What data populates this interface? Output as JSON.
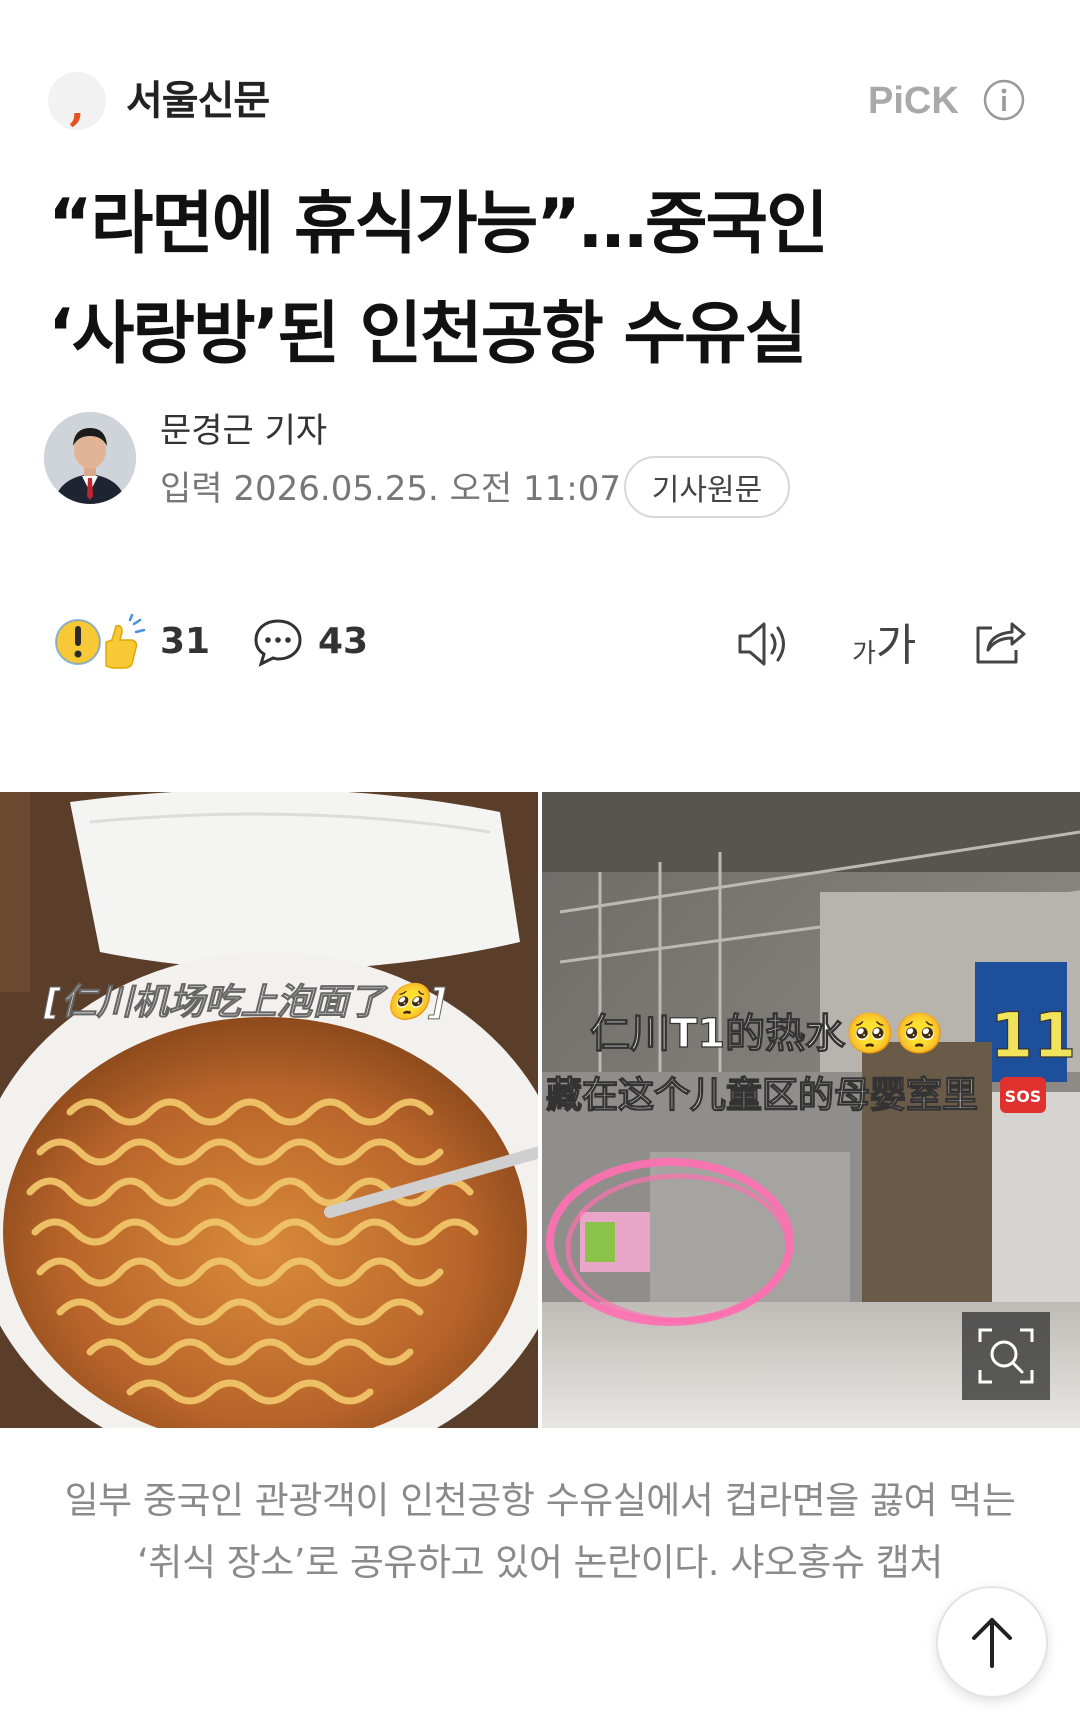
{
  "header": {
    "press_logo": "seoul-shinmun-logo",
    "press_name": "서울신문",
    "pick_label": "PiCK",
    "info_icon": "info-icon"
  },
  "article": {
    "headline_line1": "“라면에 휴식가능”…중국인",
    "headline_line2": "‘사랑방’된 인천공항 수유실",
    "reporter": "문경근 기자",
    "published": "입력 2026.05.25. 오전 11:07",
    "original_button": "기사원문"
  },
  "actions": {
    "reaction_icon": "reaction-emoji-icon",
    "reaction_count": "31",
    "comment_icon": "comment-icon",
    "comment_count": "43",
    "tts_icon": "speaker-icon",
    "font_small": "가",
    "font_big": "가",
    "share_icon": "share-icon"
  },
  "photo": {
    "left_overlay_text": "[仁川机场吃上泡面了🥺]",
    "right_overlay_line1": "仁川T1的热水🥺🥺",
    "right_overlay_number": "11",
    "right_overlay_line2": "藏在这个儿童区的母婴室里",
    "sos_badge": "SOS",
    "zoom_icon": "zoom-icon"
  },
  "caption": {
    "text": "일부 중국인 관광객이 인천공항 수유실에서 컵라면을 끓여 먹는 ‘취식 장소’로 공유하고 있어 논란이다. 샤오홍슈 캡처"
  },
  "scroll_top_icon": "arrow-up-icon"
}
